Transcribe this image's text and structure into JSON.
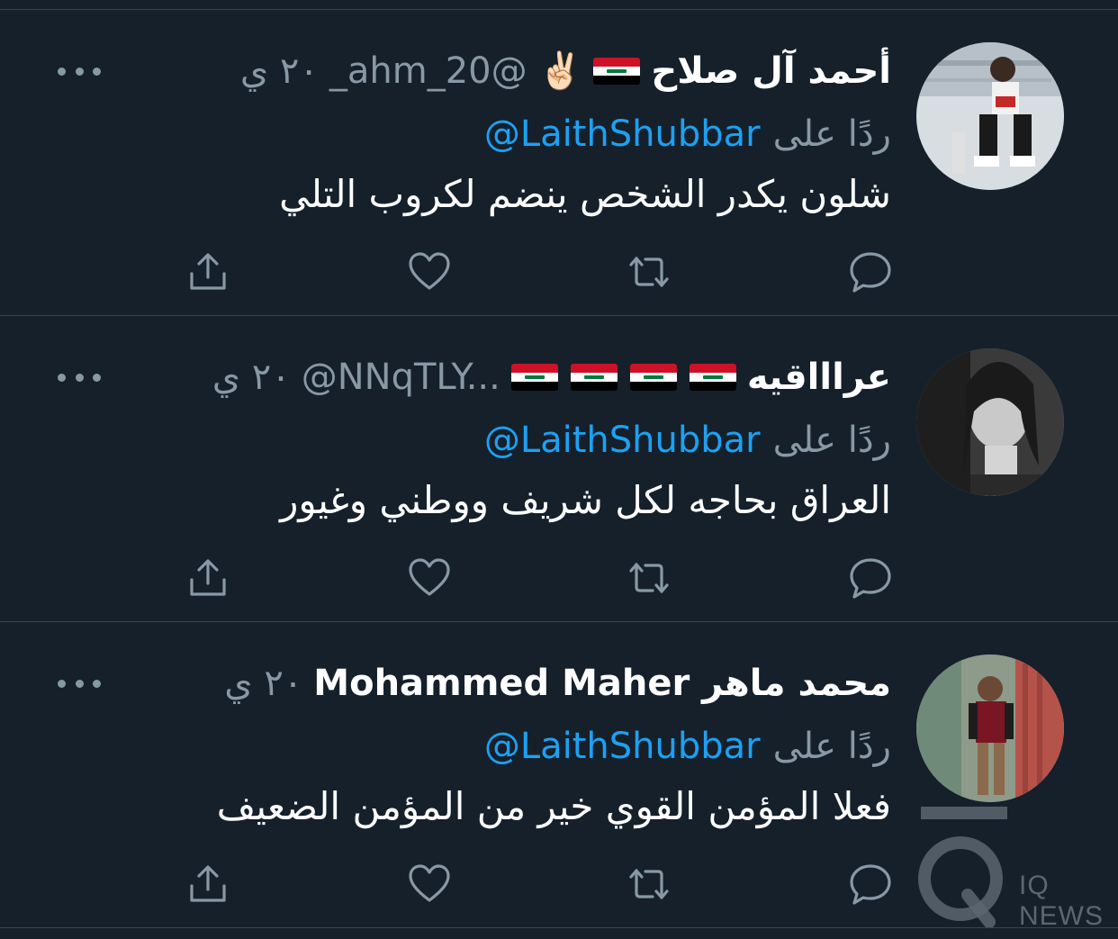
{
  "colors": {
    "background": "#15202b",
    "divider": "#38444d",
    "primary_text": "#ffffff",
    "secondary_text": "#8899a6",
    "link": "#1da1f2",
    "icon": "#8899a6"
  },
  "reply_label": "ردًا على",
  "tweets": [
    {
      "name": "أحمد آل صلاح",
      "flag_count": 1,
      "emoji": "✌🏻",
      "handle": "_ahm_20@",
      "time": "٢٠ ي",
      "reply_to": "@LaithShubbar",
      "text": "شلون يكدر الشخص ينضم لكروب التلي",
      "icons": [
        "share-icon",
        "like-icon",
        "retweet-icon",
        "reply-icon"
      ]
    },
    {
      "name": "عراااقيه",
      "flag_count": 4,
      "emoji": "",
      "handle": "@NNqTLY...",
      "time": "٢٠ ي",
      "reply_to": "@LaithShubbar",
      "text": "العراق بحاجه لكل شريف ووطني وغيور",
      "icons": [
        "share-icon",
        "like-icon",
        "retweet-icon",
        "reply-icon"
      ]
    },
    {
      "name": "محمد ماهر Mohammed Maher",
      "flag_count": 0,
      "emoji": "",
      "handle": "",
      "time": "٢٠ ي",
      "reply_to": "@LaithShubbar",
      "text": "فعلا المؤمن القوي خير من المؤمن الضعيف",
      "icons": [
        "share-icon",
        "like-icon",
        "retweet-icon",
        "reply-icon"
      ]
    }
  ],
  "watermark": {
    "text": "IQ NEWS"
  }
}
